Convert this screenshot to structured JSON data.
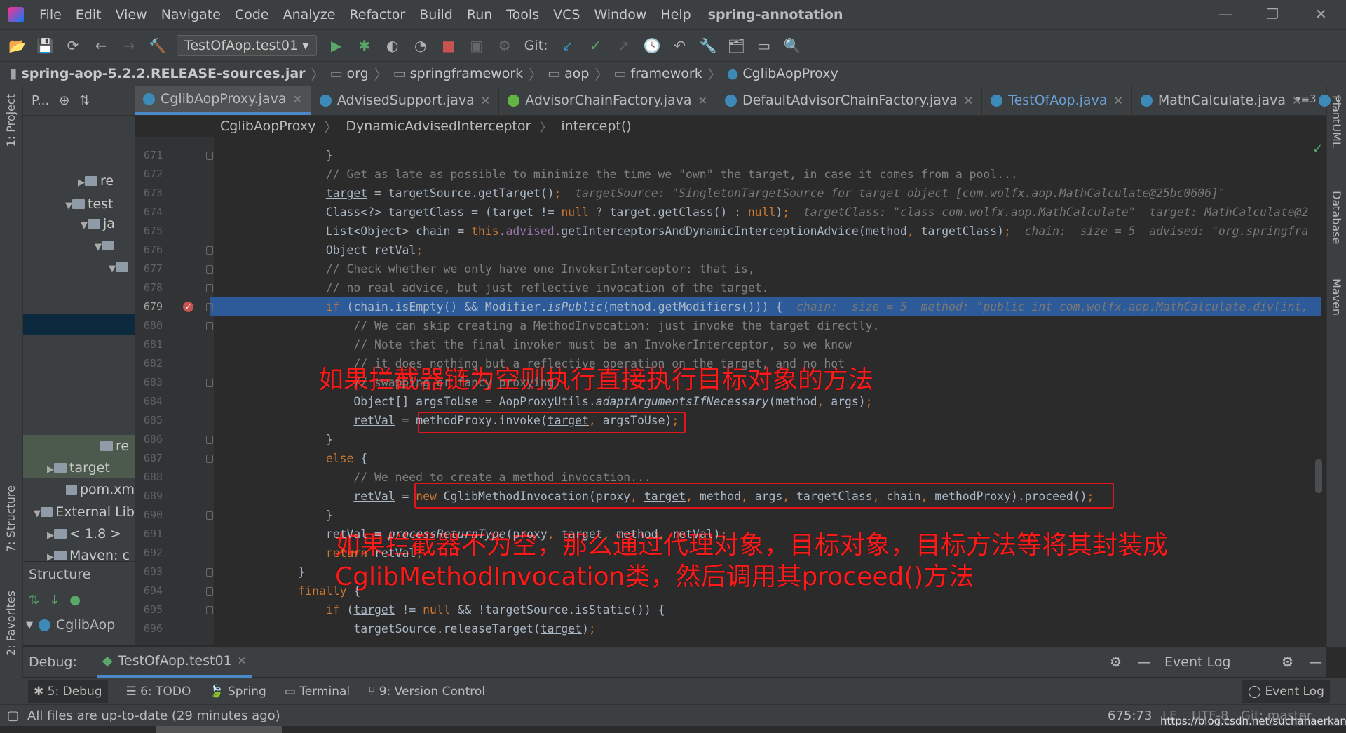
{
  "menu": {
    "items": [
      "File",
      "Edit",
      "View",
      "Navigate",
      "Code",
      "Analyze",
      "Refactor",
      "Build",
      "Run",
      "Tools",
      "VCS",
      "Window",
      "Help"
    ],
    "project_title": "spring-annotation"
  },
  "toolbar": {
    "run_config": "TestOfAop.test01",
    "git_label": "Git:"
  },
  "navbar": {
    "items": [
      "spring-aop-5.2.2.RELEASE-sources.jar",
      "org",
      "springframework",
      "aop",
      "framework",
      "CglibAopProxy"
    ]
  },
  "left_strip": {
    "project": "1: Project",
    "structure": "7: Structure",
    "favorites": "2: Favorites"
  },
  "right_strip": {
    "plantuml": "PlantUML",
    "database": "Database",
    "maven": "Maven"
  },
  "project_panel": {
    "header": "P...",
    "items": [
      {
        "label": "re",
        "arrow": "▶"
      },
      {
        "label": "test",
        "arrow": "▼"
      },
      {
        "label": "ja",
        "arrow": "▼"
      },
      {
        "label": "",
        "arrow": "▼"
      },
      {
        "label": "",
        "arrow": "▼"
      },
      {
        "label": "re",
        "arrow": ""
      },
      {
        "label": "target",
        "arrow": "▶"
      },
      {
        "label": "pom.xm",
        "arrow": ""
      },
      {
        "label": "External Lib",
        "arrow": "▼"
      },
      {
        "label": "< 1.8 >",
        "arrow": "▶"
      },
      {
        "label": "Maven: c",
        "arrow": "▶"
      }
    ]
  },
  "structure_panel": {
    "title": "Structure",
    "item": "CglibAop"
  },
  "tabs": [
    {
      "label": "CglibAopProxy.java",
      "active": true
    },
    {
      "label": "AdvisedSupport.java"
    },
    {
      "label": "AdvisorChainFactory.java"
    },
    {
      "label": "DefaultAdvisorChainFactory.java"
    },
    {
      "label": "TestOfAop.java"
    },
    {
      "label": "MathCalculate.java"
    },
    {
      "label": "["
    }
  ],
  "tabs_overflow": "3",
  "editor_breadcrumb": [
    "CglibAopProxy",
    "DynamicAdvisedInterceptor",
    "intercept()"
  ],
  "code": {
    "current_line": 679,
    "breakpoint_line": 679,
    "lines": [
      {
        "n": 671,
        "seg": [
          [
            "t",
            "                }"
          ]
        ]
      },
      {
        "n": 672,
        "seg": [
          [
            "c",
            "                // Get as late as possible to minimize the time we \"own\" the target, in case it comes from a pool..."
          ]
        ]
      },
      {
        "n": 673,
        "seg": [
          [
            "t",
            "                "
          ],
          [
            "u",
            "target"
          ],
          [
            "t",
            " = targetSource.getTarget()"
          ],
          [
            "k",
            ";"
          ],
          [
            "h",
            "  targetSource: \"SingletonTargetSource for target object [com.wolfx.aop.MathCalculate@25bc0606]\""
          ]
        ]
      },
      {
        "n": 674,
        "seg": [
          [
            "t",
            "                Class<?> targetClass = ("
          ],
          [
            "u",
            "target"
          ],
          [
            "t",
            " != "
          ],
          [
            "k",
            "null"
          ],
          [
            "t",
            " ? "
          ],
          [
            "u",
            "target"
          ],
          [
            "t",
            ".getClass() : "
          ],
          [
            "k",
            "null"
          ],
          [
            "t",
            ")"
          ],
          [
            "k",
            ";"
          ],
          [
            "h",
            "  targetClass: \"class com.wolfx.aop.MathCalculate\"  target: MathCalculate@2"
          ]
        ]
      },
      {
        "n": 675,
        "seg": [
          [
            "t",
            "                List<Object> chain = "
          ],
          [
            "k",
            "this"
          ],
          [
            "t",
            "."
          ],
          [
            "f",
            "advised"
          ],
          [
            "t",
            ".getInterceptorsAndDynamicInterceptionAdvice(method"
          ],
          [
            "k",
            ","
          ],
          [
            "t",
            " targetClass)"
          ],
          [
            "k",
            ";"
          ],
          [
            "h",
            "  chain:  size = 5  advised: \"org.springfra"
          ]
        ]
      },
      {
        "n": 676,
        "seg": [
          [
            "t",
            "                Object "
          ],
          [
            "u",
            "retVal"
          ],
          [
            "k",
            ";"
          ]
        ]
      },
      {
        "n": 677,
        "seg": [
          [
            "c",
            "                // Check whether we only have one InvokerInterceptor: that is,"
          ]
        ]
      },
      {
        "n": 678,
        "seg": [
          [
            "c",
            "                // no real advice, but just reflective invocation of the target."
          ]
        ]
      },
      {
        "n": 679,
        "seg": [
          [
            "t",
            "                "
          ],
          [
            "k",
            "if"
          ],
          [
            "t",
            " (chain.isEmpty() && Modifier."
          ],
          [
            "i",
            "isPublic"
          ],
          [
            "t",
            "(method.getModifiers())) {"
          ],
          [
            "h",
            "  chain:  size = 5  method: \"public int com.wolfx.aop.MathCalculate.div(int,"
          ]
        ]
      },
      {
        "n": 680,
        "seg": [
          [
            "c",
            "                    // We can skip creating a MethodInvocation: just invoke the target directly."
          ]
        ]
      },
      {
        "n": 681,
        "seg": [
          [
            "c",
            "                    // Note that the final invoker must be an InvokerInterceptor, so we know"
          ]
        ]
      },
      {
        "n": 682,
        "seg": [
          [
            "c",
            "                    // it does nothing but a reflective operation on the target, and no hot"
          ]
        ]
      },
      {
        "n": 683,
        "seg": [
          [
            "c",
            "                    // swapping or fancy proxying."
          ]
        ]
      },
      {
        "n": 684,
        "seg": [
          [
            "t",
            "                    Object[] argsToUse = AopProxyUtils."
          ],
          [
            "i",
            "adaptArgumentsIfNecessary"
          ],
          [
            "t",
            "(method"
          ],
          [
            "k",
            ","
          ],
          [
            "t",
            " args)"
          ],
          [
            "k",
            ";"
          ]
        ]
      },
      {
        "n": 685,
        "seg": [
          [
            "t",
            "                    "
          ],
          [
            "u",
            "retVal"
          ],
          [
            "t",
            " = methodProxy.invoke("
          ],
          [
            "u",
            "target"
          ],
          [
            "k",
            ","
          ],
          [
            "t",
            " argsToUse)"
          ],
          [
            "k",
            ";"
          ]
        ]
      },
      {
        "n": 686,
        "seg": [
          [
            "t",
            "                }"
          ]
        ]
      },
      {
        "n": 687,
        "seg": [
          [
            "t",
            "                "
          ],
          [
            "k",
            "else"
          ],
          [
            "t",
            " {"
          ]
        ]
      },
      {
        "n": 688,
        "seg": [
          [
            "c",
            "                    // We need to create a method invocation..."
          ]
        ]
      },
      {
        "n": 689,
        "seg": [
          [
            "t",
            "                    "
          ],
          [
            "u",
            "retVal"
          ],
          [
            "t",
            " = "
          ],
          [
            "k",
            "new"
          ],
          [
            "t",
            " CglibMethodInvocation(proxy"
          ],
          [
            "k",
            ","
          ],
          [
            "t",
            " "
          ],
          [
            "u",
            "target"
          ],
          [
            "k",
            ","
          ],
          [
            "t",
            " method"
          ],
          [
            "k",
            ","
          ],
          [
            "t",
            " args"
          ],
          [
            "k",
            ","
          ],
          [
            "t",
            " targetClass"
          ],
          [
            "k",
            ","
          ],
          [
            "t",
            " chain"
          ],
          [
            "k",
            ","
          ],
          [
            "t",
            " methodProxy).proceed()"
          ],
          [
            "k",
            ";"
          ]
        ]
      },
      {
        "n": 690,
        "seg": [
          [
            "t",
            "                }"
          ]
        ]
      },
      {
        "n": 691,
        "seg": [
          [
            "t",
            "                "
          ],
          [
            "u",
            "retVal"
          ],
          [
            "t",
            " = "
          ],
          [
            "i",
            "processReturnType"
          ],
          [
            "t",
            "(proxy"
          ],
          [
            "k",
            ","
          ],
          [
            "t",
            " "
          ],
          [
            "u",
            "target"
          ],
          [
            "k",
            ","
          ],
          [
            "t",
            " method"
          ],
          [
            "k",
            ","
          ],
          [
            "t",
            " "
          ],
          [
            "u",
            "retVal"
          ],
          [
            "t",
            ")"
          ],
          [
            "k",
            ";"
          ]
        ]
      },
      {
        "n": 692,
        "seg": [
          [
            "t",
            "                "
          ],
          [
            "k",
            "return "
          ],
          [
            "u",
            "retVal"
          ],
          [
            "k",
            ";"
          ]
        ]
      },
      {
        "n": 693,
        "seg": [
          [
            "t",
            "            }"
          ]
        ]
      },
      {
        "n": 694,
        "seg": [
          [
            "t",
            "            "
          ],
          [
            "k",
            "finally"
          ],
          [
            "t",
            " {"
          ]
        ]
      },
      {
        "n": 695,
        "seg": [
          [
            "t",
            "                "
          ],
          [
            "k",
            "if"
          ],
          [
            "t",
            " ("
          ],
          [
            "u",
            "target"
          ],
          [
            "t",
            " != "
          ],
          [
            "k",
            "null"
          ],
          [
            "t",
            " && !targetSource.isStatic()) {"
          ]
        ]
      },
      {
        "n": 696,
        "seg": [
          [
            "t",
            "                    targetSource.releaseTarget("
          ],
          [
            "u",
            "target"
          ],
          [
            "t",
            ")"
          ],
          [
            "k",
            ";"
          ]
        ]
      }
    ]
  },
  "annotations": {
    "empty_chain": "如果拦截器链为空则执行直接执行目标对象的方法",
    "non_empty_line1": "如果拦截器不为空，那么通过代理对象，目标对象，目标方法等将其封装成",
    "non_empty_line2": "CglibMethodInvocation类，然后调用其proceed()方法",
    "color": "#ff1a1a"
  },
  "debug_bar": {
    "label": "Debug:",
    "session": "TestOfAop.test01",
    "event_log": "Event Log"
  },
  "bottom_tabs": [
    "5: Debug",
    "6: TODO",
    "Spring",
    "Terminal",
    "9: Version Control"
  ],
  "bottom_right_tab": "Event Log",
  "status": {
    "message": "All files are up-to-date (29 minutes ago)",
    "position": "675:73",
    "line_sep": "LF",
    "encoding": "UTF-8",
    "git": "Git: master",
    "watermark": "https://blog.csdn.net/suchahaerkang"
  },
  "colors": {
    "keyword": "#cc7832",
    "comment": "#808080",
    "text": "#a9b7c6",
    "field": "#9876aa",
    "current_line": "#2d5a98",
    "accent": "#4a88c7"
  }
}
